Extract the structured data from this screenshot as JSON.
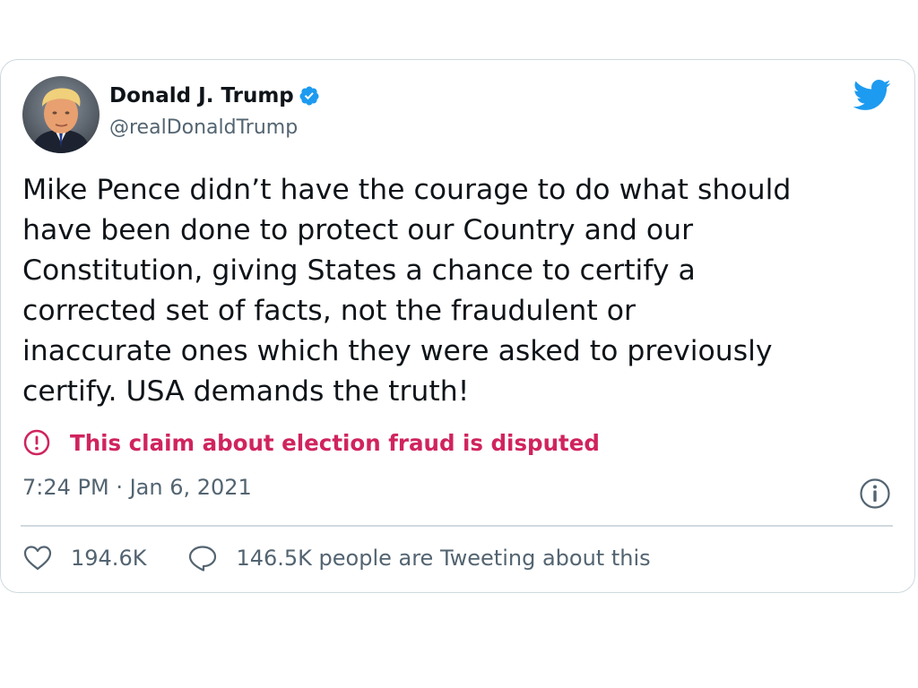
{
  "tweet": {
    "author": {
      "name": "Donald J. Trump",
      "handle": "@realDonaldTrump",
      "verified": true,
      "avatar_icon": "profile-photo"
    },
    "brand_icon": "twitter-bird-icon",
    "text": "Mike Pence didn’t have the courage to do what should\nhave been done to protect our Country and our\nConstitution, giving States a chance to certify a\ncorrected set of facts, not the fraudulent or\ninaccurate ones which they were asked to previously\ncertify. USA demands the truth!",
    "warning": {
      "icon": "exclamation-circle-icon",
      "text": "This claim about election fraud is disputed",
      "color": "#d0245e"
    },
    "timestamp": "7:24 PM · Jan 6, 2021",
    "info_icon": "info-icon",
    "stats": {
      "likes": "194.6K",
      "tweeting": "146.5K people are Tweeting about this"
    }
  },
  "colors": {
    "text": "#0f1419",
    "secondary": "#536471",
    "twitter_blue": "#1d9bf0",
    "border": "#cfd9de",
    "warning": "#d0245e"
  }
}
